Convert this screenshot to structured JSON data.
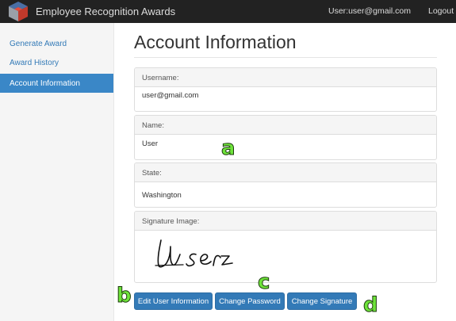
{
  "navbar": {
    "brand": "Employee Recognition Awards",
    "user": "User:user@gmail.com",
    "logout": "Logout"
  },
  "sidebar": {
    "items": [
      {
        "label": "Generate Award"
      },
      {
        "label": "Award History"
      },
      {
        "label": "Account Information",
        "active": true
      }
    ]
  },
  "main": {
    "title": "Account Information",
    "panels": [
      {
        "heading": "Username:",
        "value": "user@gmail.com"
      },
      {
        "heading": "Name:",
        "value": "User"
      },
      {
        "heading": "State:",
        "value": "Washington"
      },
      {
        "heading": "Signature Image:",
        "value": "User"
      }
    ],
    "buttons": {
      "edit": "Edit User Information",
      "password": "Change Password",
      "signature": "Change Signature"
    }
  },
  "annotations": {
    "a": "a",
    "b": "b",
    "c": "c",
    "d": "d"
  },
  "colors": {
    "navbar": "#222222",
    "accent": "#337ab7",
    "active": "#3a87c7",
    "marker": "#6ee33a"
  }
}
